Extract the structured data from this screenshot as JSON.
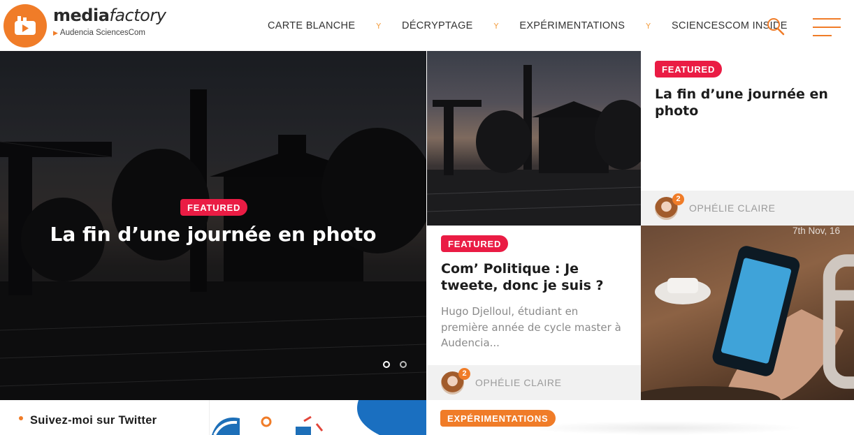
{
  "brand": {
    "name_bold": "media",
    "name_light": "factory",
    "tagline": "Audencia SciencesCom",
    "accent_color": "#f07c28",
    "icon": "factory-icon"
  },
  "nav": {
    "items": [
      {
        "label": "CARTE BLANCHE"
      },
      {
        "label": "DÉCRYPTAGE"
      },
      {
        "label": "EXPÉRIMENTATIONS"
      },
      {
        "label": "SCIENCESCOM INSIDE"
      }
    ],
    "separator": "Y",
    "search_icon": "search-icon",
    "menu_icon": "hamburger-menu-icon"
  },
  "hero": {
    "badge": "FEATURED",
    "title": "La fin d’une journée en photo",
    "slides_total": 2,
    "active_slide": 1
  },
  "cards": [
    {
      "badge": "FEATURED",
      "title": "La fin d’une journée en photo",
      "author": "OPHÉLIE CLAIRE",
      "comment_count": "2"
    },
    {
      "badge": "FEATURED",
      "title": "Com’ Politique : Je tweete, donc je suis ?",
      "excerpt": "Hugo Djelloul, étudiant en première année de cycle master à Audencia...",
      "author": "OPHÉLIE CLAIRE",
      "comment_count": "2"
    }
  ],
  "phone_tile": {
    "date": "7th Nov, 16",
    "date_icon": "calendar-icon"
  },
  "bottom": {
    "widget_title": "Suivez-moi sur Twitter",
    "category_badge": "EXPÉRIMENTATIONS"
  },
  "colors": {
    "featured_badge": "#ea1c44",
    "category_badge": "#f07c28",
    "author_bar": "#f1f1f1"
  }
}
